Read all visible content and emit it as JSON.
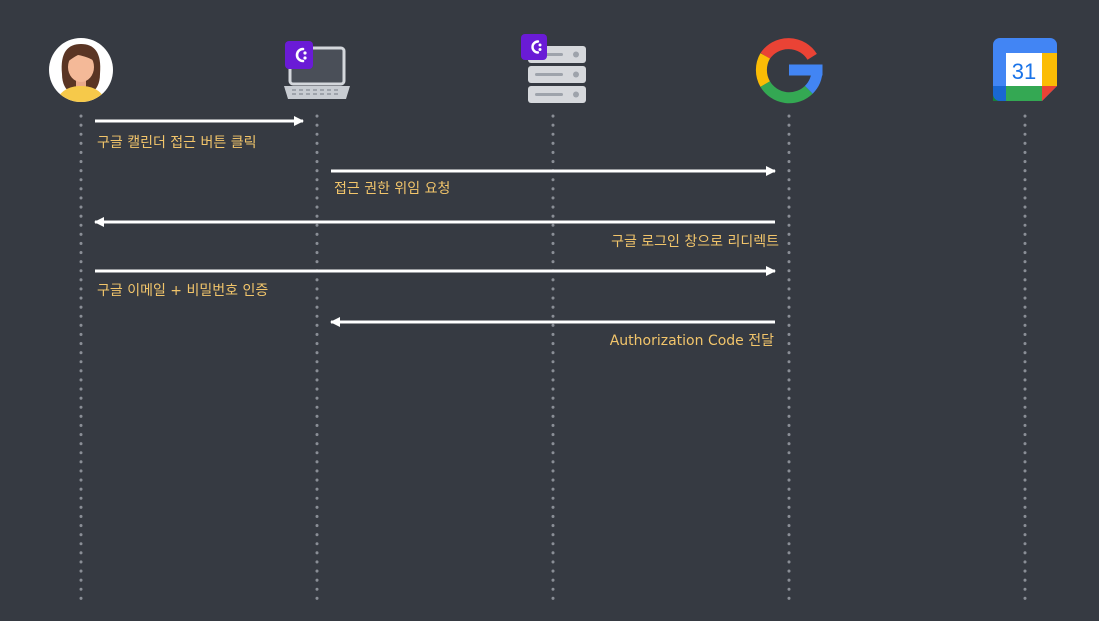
{
  "participants": [
    {
      "id": "user",
      "icon": "user-avatar-icon"
    },
    {
      "id": "client-app",
      "icon": "laptop-icon",
      "badge": "brand-logo-icon"
    },
    {
      "id": "backend-server",
      "icon": "server-icon",
      "badge": "brand-logo-icon"
    },
    {
      "id": "google",
      "icon": "google-logo-icon"
    },
    {
      "id": "google-calendar",
      "icon": "google-calendar-icon",
      "icon_text": "31"
    }
  ],
  "messages": [
    {
      "label": "구글 캘린더 접근 버튼 클릭",
      "from": "user",
      "to": "client-app"
    },
    {
      "label": "접근 권한 위임 요청",
      "from": "client-app",
      "to": "google"
    },
    {
      "label": "구글 로그인 창으로 리디렉트",
      "from": "google",
      "to": "user"
    },
    {
      "label": "구글 이메일 + 비밀번호 인증",
      "from": "user",
      "to": "google"
    },
    {
      "label": "Authorization Code 전달",
      "from": "google",
      "to": "client-app"
    }
  ],
  "colors": {
    "background": "#363a42",
    "arrow": "#ffffff",
    "label": "#f2c56b",
    "lifeline": "#8a8e96",
    "brand_purple": "#6a1bd6"
  }
}
